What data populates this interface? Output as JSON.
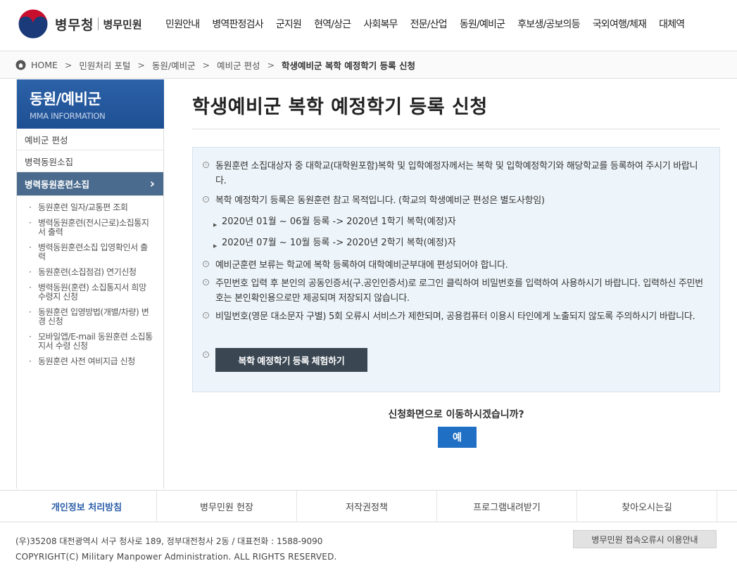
{
  "header": {
    "logo_text": "병무청",
    "logo_sub": "병무민원",
    "nav": [
      "민원안내",
      "병역판정검사",
      "군지원",
      "현역/상근",
      "사회복무",
      "전문/산업",
      "동원/예비군",
      "후보생/공보의등",
      "국외여행/체재",
      "대체역"
    ]
  },
  "breadcrumb": {
    "home": "HOME",
    "sep": ">",
    "items": [
      "민원처리 포털",
      "동원/예비군",
      "예비군 편성"
    ],
    "current": "학생예비군 복학 예정학기 등록 신청"
  },
  "sidebar": {
    "title": "동원/예비군",
    "subtitle": "MMA INFORMATION",
    "items": [
      "예비군 편성",
      "병력동원소집",
      "병력동원훈련소집"
    ],
    "active_arrow": "›",
    "subitems": [
      "동원훈련 일자/교통편 조회",
      "병력동원훈련(전시근로)소집통지서 출력",
      "병력동원훈련소집 입영확인서 출력",
      "동원훈련(소집점검) 연기신청",
      "병력동원(훈련) 소집통지서 희망수령지 신청",
      "동원훈련 입영방법(개별/차량) 변경 신청",
      "모바일앱/E-mail 동원훈련 소집통지서 수령 신청",
      "동원훈련 사전 여비지급 신청"
    ]
  },
  "main": {
    "title": "학생예비군 복학 예정학기 등록 신청",
    "notices": [
      "동원훈련 소집대상자 중 대학교(대학원포함)복학 및 입학예정자께서는 복학 및 입학예정학기와 해당학교를 등록하여 주시기 바랍니다.",
      "복학 예정학기 등록은 동원훈련 참고 목적입니다. (학교의 학생예비군 편성은 별도사항임)"
    ],
    "subnotices": [
      "2020년 01월 ~ 06월 등록 -> 2020년 1학기 복학(예정)자",
      "2020년 07월 ~ 10월 등록 -> 2020년 2학기 복학(예정)자"
    ],
    "notices2": [
      "예비군훈련 보류는 학교에 복학 등록하여 대학예비군부대에 편성되어야 합니다.",
      "주민번호 입력 후 본인의 공동인증서(구.공인인증서)로 로그인 클릭하여 비밀번호를 입력하여 사용하시기 바랍니다. 입력하신 주민번호는 본인확인용으로만 제공되며 저장되지 않습니다.",
      "비밀번호(영문 대소문자 구별) 5회 오류시 서비스가 제한되며, 공용컴퓨터 이용시 타인에게 노출되지 않도록 주의하시기 바랍니다."
    ],
    "experience_button": "복학 예정학기 등록 체험하기",
    "confirm_text": "신청화면으로 이동하시겠습니까?",
    "yes_button": "예"
  },
  "footer": {
    "links": [
      "개인정보 처리방침",
      "병무민원 헌장",
      "저작권정책",
      "프로그램내려받기",
      "찾아오시는길"
    ],
    "address": "(우)35208 대전광역시 서구 청사로 189, 정부대전청사 2동 / 대표전화 : 1588-9090",
    "copyright": "COPYRIGHT(C) Military Manpower Administration. ALL RIGHTS RESERVED.",
    "error_guide": "병무민원 접속오류시 이용안내"
  },
  "colors": {
    "primary_blue": "#1f6fc5",
    "side_header": "#2c62a8",
    "active_menu": "#4a6b8e",
    "notice_bg": "#eef5fa",
    "button_dark": "#3a4753"
  }
}
